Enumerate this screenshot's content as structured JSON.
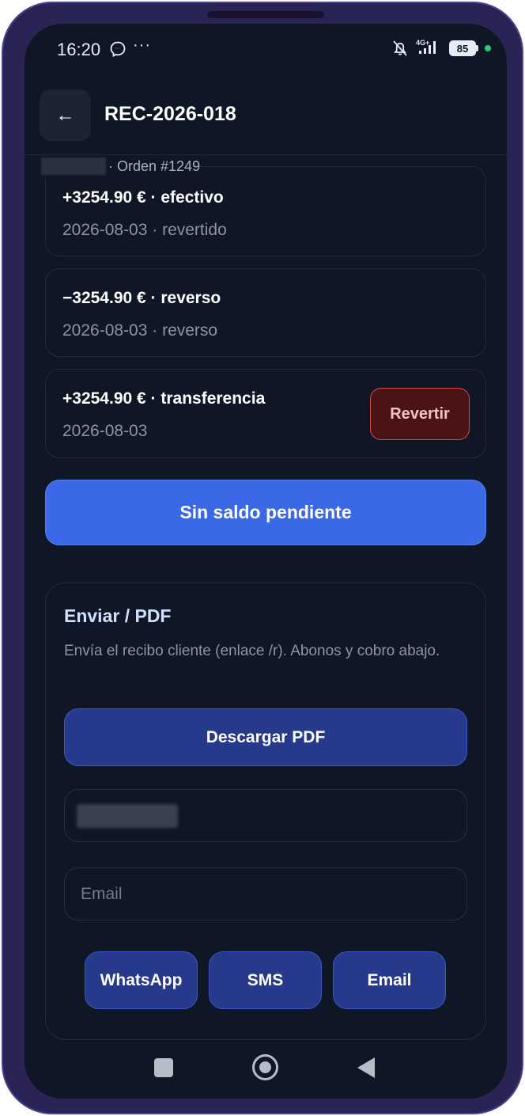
{
  "status_bar": {
    "time": "16:20",
    "more": "···",
    "network": "4G+",
    "battery": "85"
  },
  "header": {
    "back": "←",
    "title": "REC-2026-018",
    "order": "· Orden #1249"
  },
  "payments": [
    {
      "title": "+3254.90 € · efectivo",
      "subtitle": "2026-08-03 · revertido"
    },
    {
      "title": "−3254.90 € · reverso",
      "subtitle": "2026-08-03 · reverso"
    },
    {
      "title": "+3254.90 € · transferencia",
      "subtitle": "2026-08-03",
      "action": "Revertir"
    }
  ],
  "balance_button": "Sin saldo pendiente",
  "send": {
    "title": "Enviar / PDF",
    "description": "Envía el recibo cliente (enlace /r). Abonos y cobro abajo.",
    "pdf_button": "Descargar PDF",
    "email_placeholder": "Email",
    "share_buttons": [
      "WhatsApp",
      "SMS",
      "Email"
    ]
  },
  "colors": {
    "background": "#0f1626",
    "primary": "#3a68e6",
    "secondary_button": "#26398a",
    "danger": "#d84a4a"
  }
}
